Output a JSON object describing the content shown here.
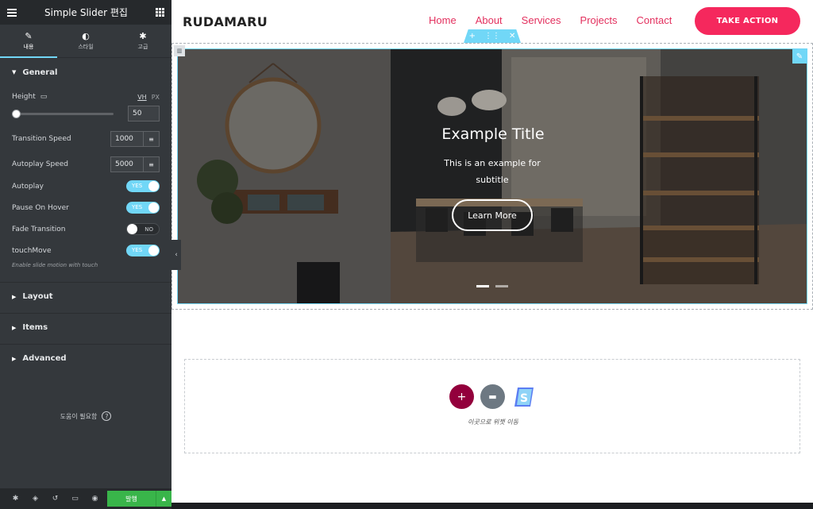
{
  "panel": {
    "title": "Simple Slider 편집",
    "tabs": [
      {
        "label": "내용",
        "icon": "pencil-icon"
      },
      {
        "label": "스타일",
        "icon": "contrast-icon"
      },
      {
        "label": "고급",
        "icon": "gear-icon"
      }
    ],
    "general": {
      "title": "General",
      "height_label": "Height",
      "unit_vh": "VH",
      "unit_px": "PX",
      "height_value": "50",
      "transition_label": "Transition Speed",
      "transition_value": "1000",
      "autoplay_speed_label": "Autoplay Speed",
      "autoplay_speed_value": "5000",
      "autoplay_label": "Autoplay",
      "autoplay_state": "YES",
      "pause_label": "Pause On Hover",
      "pause_state": "YES",
      "fade_label": "Fade Transition",
      "fade_state": "NO",
      "touch_label": "touchMove",
      "touch_state": "YES",
      "touch_hint": "Enable slide motion with touch"
    },
    "sections": [
      "Layout",
      "Items",
      "Advanced"
    ],
    "help": "도움이 필요함",
    "publish": "발행"
  },
  "site": {
    "logo": "RUDAMARU",
    "nav": [
      "Home",
      "About",
      "Services",
      "Projects",
      "Contact"
    ],
    "cta": "TAKE ACTION"
  },
  "slider": {
    "title": "Example Title",
    "subtitle": "This is an example for subtitle",
    "button": "Learn More",
    "slide_count": 2,
    "active_slide": 1
  },
  "dropzone": {
    "text": "이곳으로 위젯 이동"
  },
  "colors": {
    "accent_cyan": "#71d7f7",
    "nav_pink": "#e3305e",
    "cta_pink": "#f5285d",
    "publish_green": "#39b54a",
    "panel_dark": "#34383c"
  }
}
